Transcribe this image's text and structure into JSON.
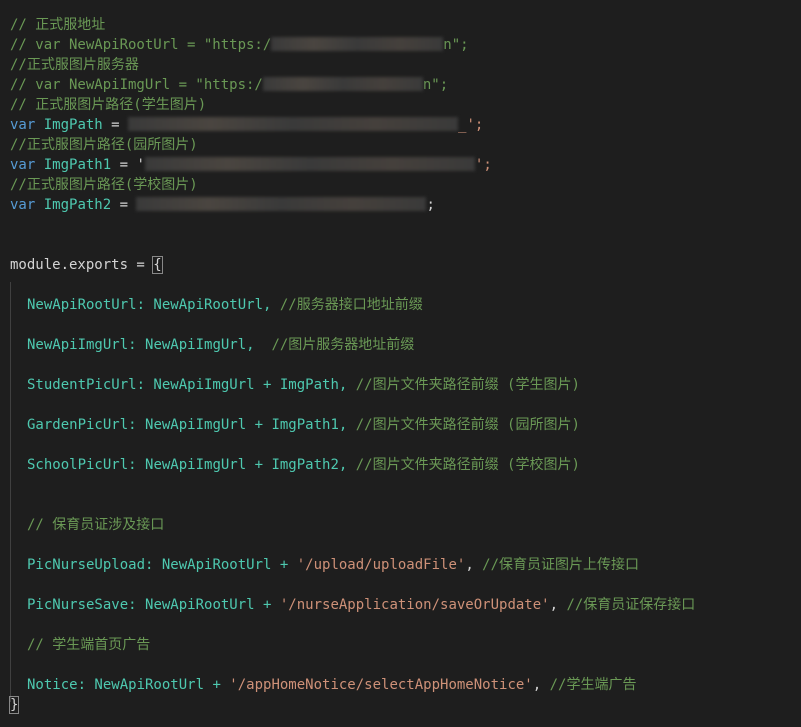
{
  "editor": {
    "lines": {
      "l1": "// 正式服地址",
      "l2a": "// var NewApiRootUrl = \"https:/",
      "l2b": "n\";",
      "l3": "//正式服图片服务器",
      "l4a": "// var NewApiImgUrl = \"https:/",
      "l4b": "n\";",
      "l5": "// 正式服图片路径(学生图片)",
      "l6kw": "var",
      "l6name": "ImgPath",
      "l6eq": " = ",
      "l6tail": "_';",
      "l7": "//正式服图片路径(园所图片)",
      "l8kw": "var",
      "l8name": "ImgPath1",
      "l8eq": " = '",
      "l8tail": "';",
      "l9": "//正式服图片路径(学校图片)",
      "l10kw": "var",
      "l10name": "ImgPath2",
      "l10eq": " = ",
      "l10tail": ";",
      "l13a": "module.exports = ",
      "l13b": "{",
      "l15p": "NewApiRootUrl",
      "l15v": ": NewApiRootUrl, ",
      "l15c": "//服务器接口地址前缀",
      "l17p": "NewApiImgUrl",
      "l17v": ": NewApiImgUrl,  ",
      "l17c": "//图片服务器地址前缀",
      "l19p": "StudentPicUrl",
      "l19v": ": NewApiImgUrl + ImgPath, ",
      "l19c": "//图片文件夹路径前缀 (学生图片)",
      "l21p": "GardenPicUrl",
      "l21v": ": NewApiImgUrl + ImgPath1, ",
      "l21c": "//图片文件夹路径前缀 (园所图片)",
      "l23p": "SchoolPicUrl",
      "l23v": ": NewApiImgUrl + ImgPath2, ",
      "l23c": "//图片文件夹路径前缀 (学校图片)",
      "l26c": "// 保育员证涉及接口",
      "l28p": "PicNurseUpload",
      "l28v": ": NewApiRootUrl + ",
      "l28s": "'/upload/uploadFile'",
      "l28e": ", ",
      "l28c": "//保育员证图片上传接口",
      "l30p": "PicNurseSave",
      "l30v": ": NewApiRootUrl + ",
      "l30s": "'/nurseApplication/saveOrUpdate'",
      "l30e": ", ",
      "l30c": "//保育员证保存接口",
      "l32c": "// 学生端首页广告",
      "l34p": "Notice",
      "l34v": ": NewApiRootUrl + ",
      "l34s": "'/appHomeNotice/selectAppHomeNotice'",
      "l34e": ", ",
      "l34c": "//学生端广告",
      "l35": "}"
    },
    "colors": {
      "background": "#1e1e1e",
      "comment": "#6a9955",
      "keyword": "#569cd6",
      "identifier": "#4ec9b0",
      "string": "#ce9178",
      "text": "#d4d4d4"
    }
  }
}
